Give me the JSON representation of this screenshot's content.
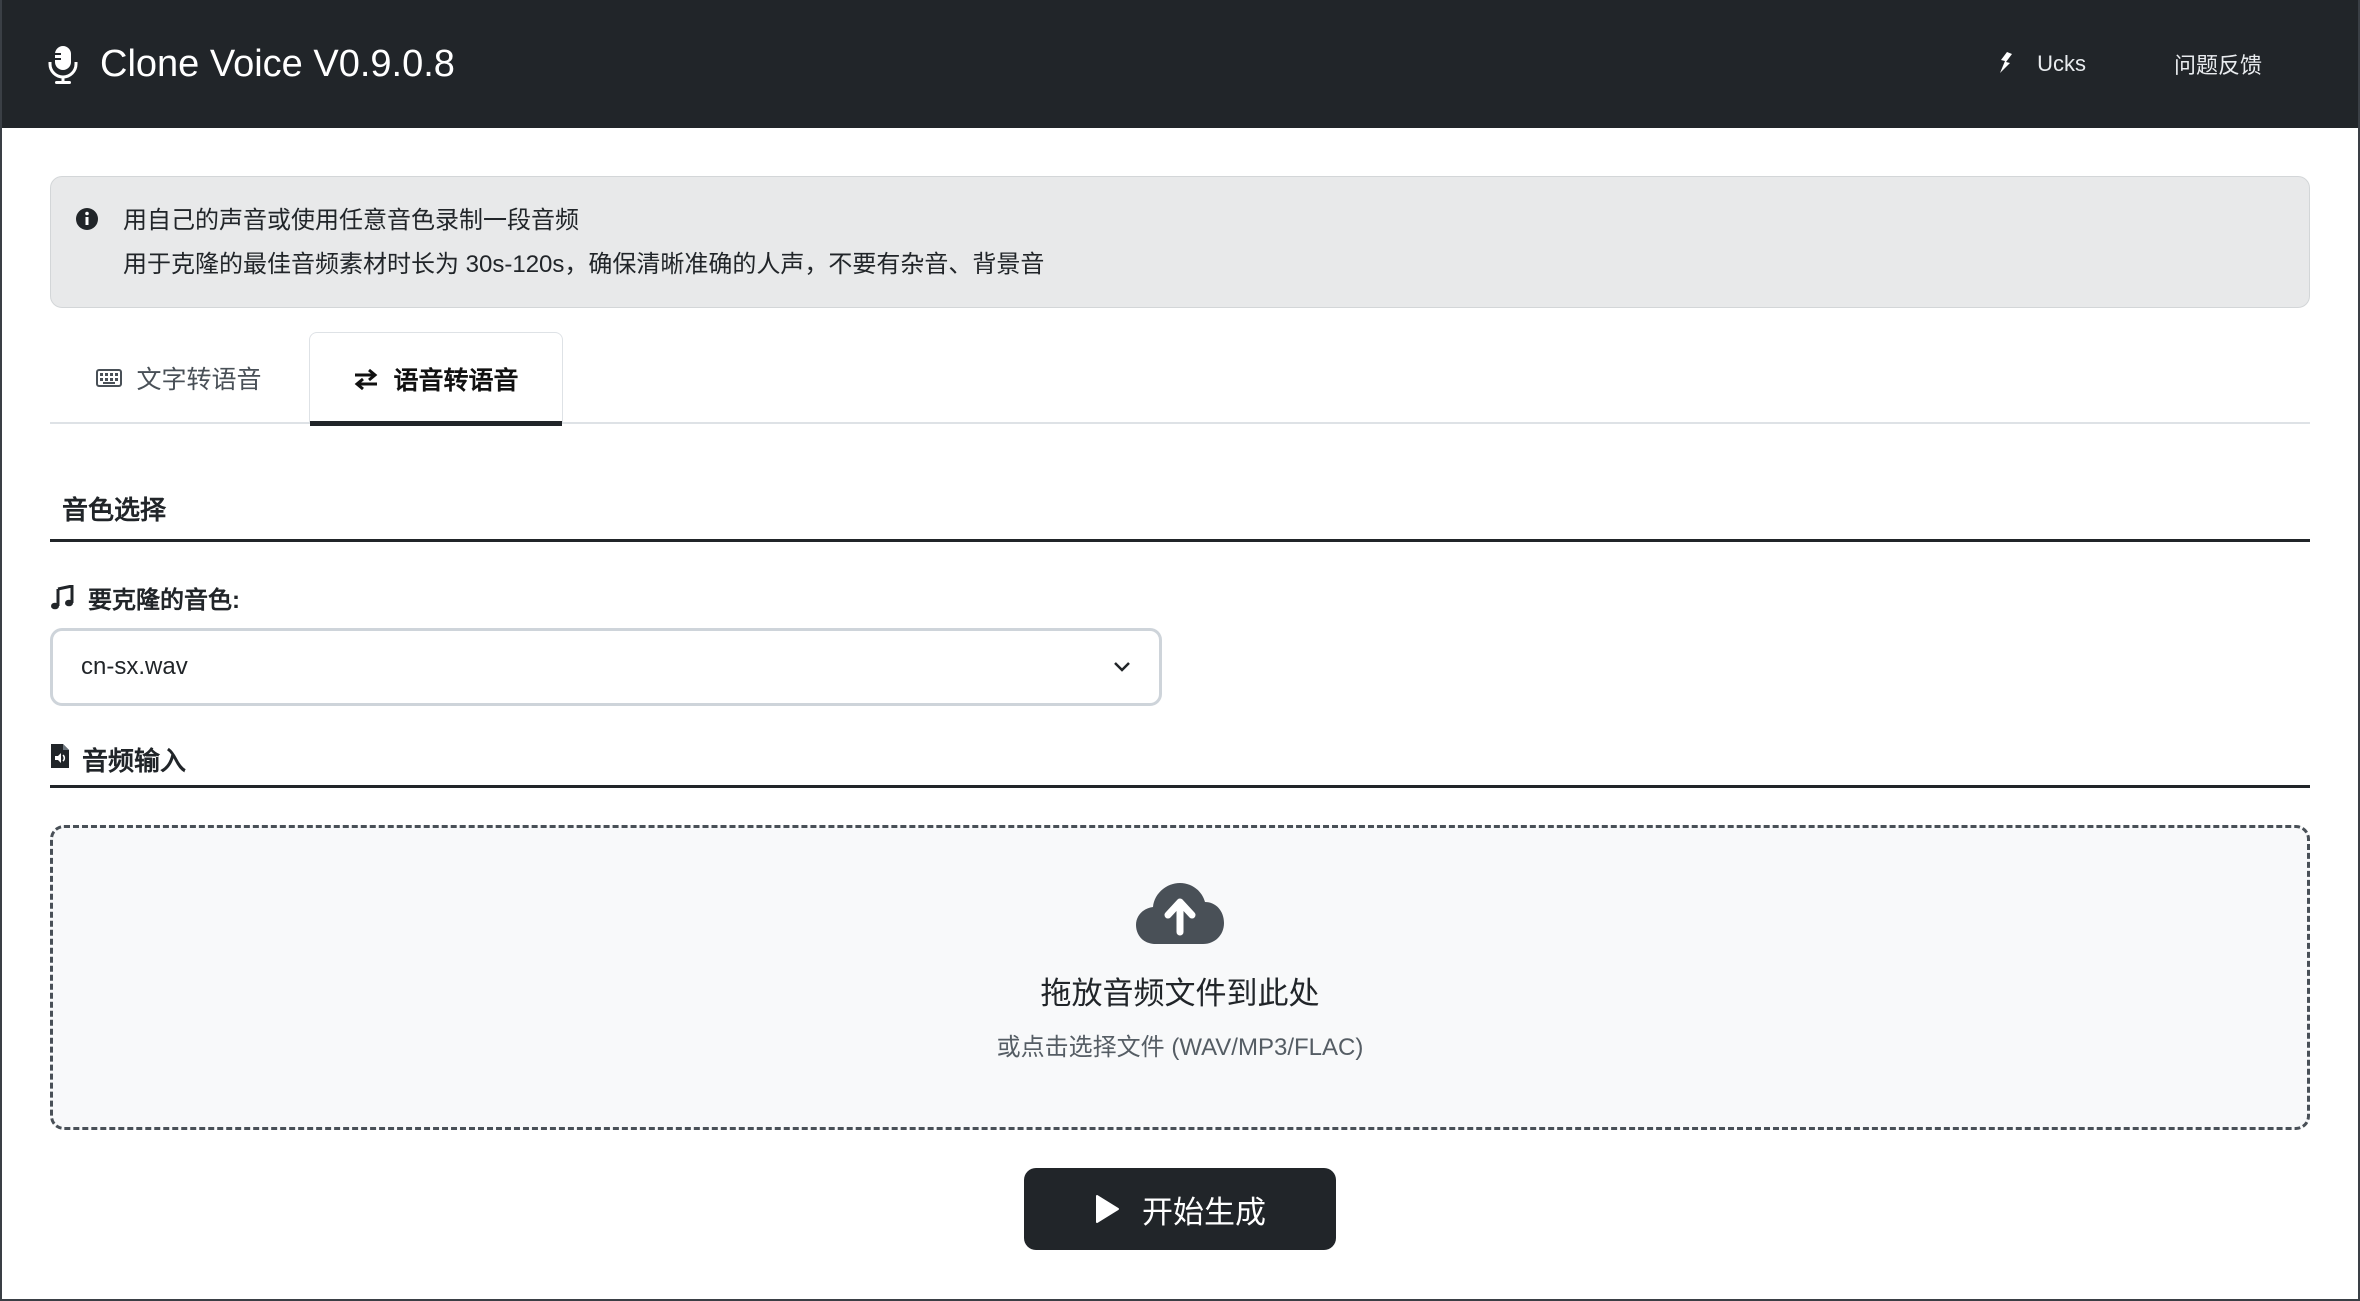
{
  "header": {
    "title": "Clone Voice V0.9.0.8",
    "links": [
      {
        "label": "Ucks",
        "icon": "hand-icon"
      },
      {
        "label": "问题反馈",
        "icon": "none"
      }
    ]
  },
  "alert": {
    "line1": "用自己的声音或使用任意音色录制一段音频",
    "line2": "用于克隆的最佳音频素材时长为 30s-120s，确保清晰准确的人声，不要有杂音、背景音"
  },
  "tabs": [
    {
      "label": "文字转语音",
      "icon": "keyboard-icon",
      "active": false
    },
    {
      "label": "语音转语音",
      "icon": "exchange-icon",
      "active": true
    }
  ],
  "voice_section": {
    "title": "音色选择",
    "label": "要克隆的音色:",
    "selected": "cn-sx.wav"
  },
  "audio_section": {
    "title": "音频输入",
    "dropzone_title": "拖放音频文件到此处",
    "dropzone_sub": "或点击选择文件 (WAV/MP3/FLAC)"
  },
  "generate_button": {
    "label": "开始生成"
  },
  "colors": {
    "header_bg": "#212529",
    "alert_bg": "#e8e9ea",
    "dropzone_bg": "#f8f9fa",
    "button_bg": "#212529"
  }
}
